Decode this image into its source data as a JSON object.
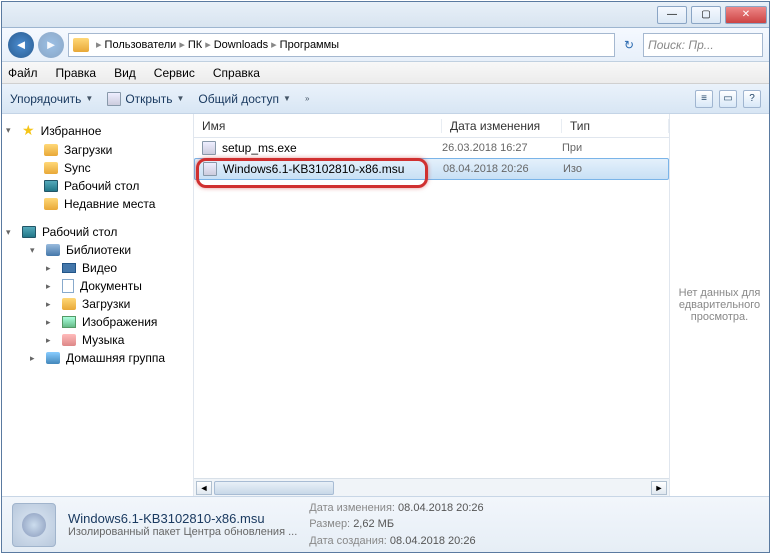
{
  "titlebar": {
    "min": "—",
    "max": "▢",
    "close": "✕"
  },
  "nav": {
    "back": "◄",
    "fwd": "►",
    "crumbs": [
      "Пользователи",
      "ПК",
      "Downloads",
      "Программы"
    ],
    "sep": "▸",
    "refresh": "↻",
    "search_placeholder": "Поиск: Пр..."
  },
  "menu": {
    "file": "Файл",
    "edit": "Правка",
    "view": "Вид",
    "tools": "Сервис",
    "help": "Справка"
  },
  "toolbar": {
    "organize": "Упорядочить",
    "open": "Открыть",
    "share": "Общий доступ",
    "dropdown": "▼",
    "more": "»"
  },
  "columns": {
    "name": "Имя",
    "date": "Дата изменения",
    "type": "Тип"
  },
  "sidebar": {
    "favorites": "Избранное",
    "downloads": "Загрузки",
    "sync": "Sync",
    "desktop": "Рабочий стол",
    "recent": "Недавние места",
    "desktop2": "Рабочий стол",
    "libraries": "Библиотеки",
    "videos": "Видео",
    "documents": "Документы",
    "downloads2": "Загрузки",
    "images": "Изображения",
    "music": "Музыка",
    "homegroup": "Домашняя группа"
  },
  "files": [
    {
      "name": "setup_ms.exe",
      "date": "26.03.2018 16:27",
      "type": "При"
    },
    {
      "name": "Windows6.1-KB3102810-x86.msu",
      "date": "08.04.2018 20:26",
      "type": "Изо"
    }
  ],
  "preview": {
    "nodata": "Нет данных для едварительного просмотра."
  },
  "status": {
    "filename": "Windows6.1-KB3102810-x86.msu",
    "filedesc": "Изолированный пакет Центра обновления ...",
    "date_label": "Дата изменения:",
    "date": "08.04.2018 20:26",
    "size_label": "Размер:",
    "size": "2,62 МБ",
    "created_label": "Дата создания:",
    "created": "08.04.2018 20:26"
  },
  "scroll": {
    "left": "◄",
    "right": "►"
  }
}
